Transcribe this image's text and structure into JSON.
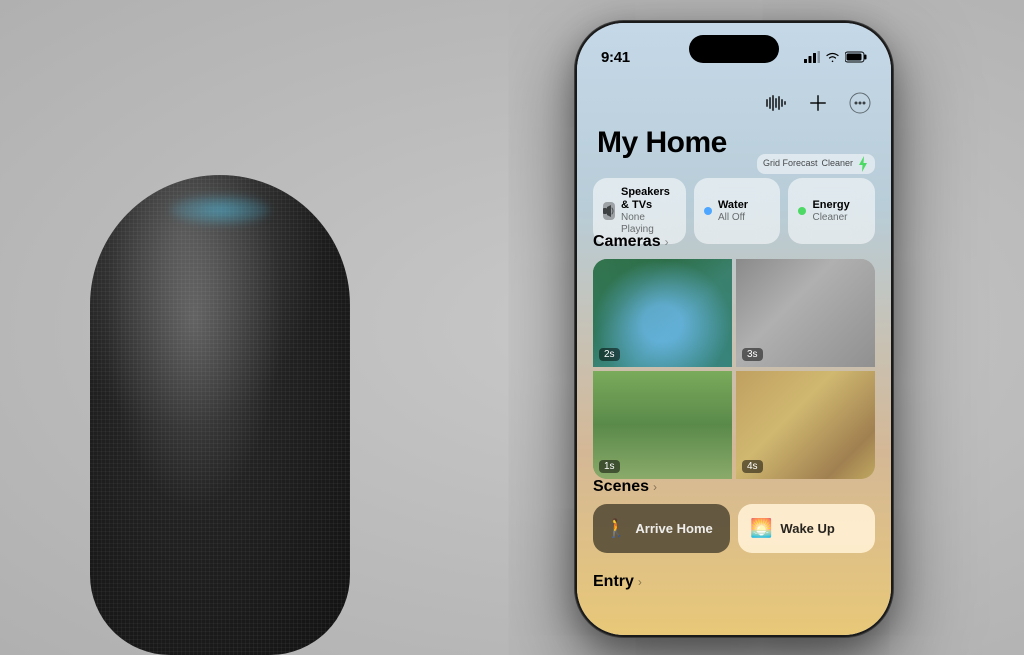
{
  "page": {
    "background": "#c8c8c8"
  },
  "status_bar": {
    "time": "9:41"
  },
  "app": {
    "title": "My Home",
    "grid_forecast": {
      "label": "Grid Forecast",
      "sublabel": "Cleaner"
    },
    "header_icons": {
      "waveform": "waveform-icon",
      "add": "+",
      "more": "···"
    }
  },
  "tiles": [
    {
      "id": "speakers",
      "title": "Speakers & TVs",
      "subtitle": "None Playing",
      "icon_type": "speaker"
    },
    {
      "id": "water",
      "title": "Water",
      "subtitle": "All Off",
      "icon_type": "dot-water"
    },
    {
      "id": "energy",
      "title": "Energy",
      "subtitle": "Cleaner",
      "icon_type": "dot-energy"
    }
  ],
  "cameras": {
    "section_label": "Cameras",
    "chevron": "›",
    "feeds": [
      {
        "id": "pool",
        "timestamp": "2s",
        "type": "pool"
      },
      {
        "id": "indoor",
        "timestamp": "3s",
        "type": "indoor"
      },
      {
        "id": "garden",
        "timestamp": "1s",
        "type": "garden"
      },
      {
        "id": "living",
        "timestamp": "4s",
        "type": "living"
      }
    ]
  },
  "scenes": {
    "section_label": "Scenes",
    "chevron": "›",
    "items": [
      {
        "id": "arrive-home",
        "label": "Arrive Home",
        "icon": "🚶",
        "variant": "dark"
      },
      {
        "id": "wake-up",
        "label": "Wake Up",
        "icon": "🌅",
        "variant": "light"
      }
    ]
  },
  "entry": {
    "section_label": "Entry",
    "chevron": "›"
  }
}
